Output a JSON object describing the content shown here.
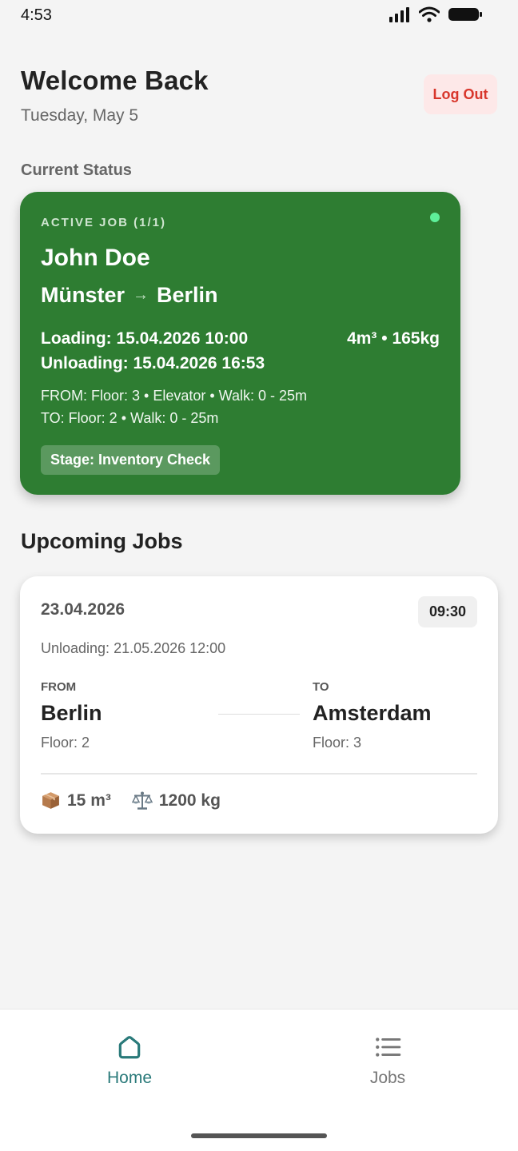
{
  "status_bar": {
    "time": "4:53"
  },
  "header": {
    "title": "Welcome Back",
    "date": "Tuesday, May 5",
    "logout_label": "Log Out"
  },
  "current_status": {
    "label": "Current Status",
    "active_job": {
      "tag": "ACTIVE JOB (1/1)",
      "customer": "John Doe",
      "origin": "Münster",
      "arrow": "→",
      "destination": "Berlin",
      "loading": "Loading: 15.04.2026 10:00",
      "unloading": "Unloading: 15.04.2026 16:53",
      "capacity": "4m³ • 165kg",
      "from_details": "FROM: Floor: 3 • Elevator • Walk: 0 - 25m",
      "to_details": "TO: Floor: 2 • Walk: 0 - 25m",
      "stage": "Stage: Inventory Check",
      "card_color": "#2e7d32",
      "indicator_color": "#5ef09a"
    }
  },
  "upcoming": {
    "title": "Upcoming Jobs",
    "jobs": [
      {
        "date": "23.04.2026",
        "time": "09:30",
        "unloading": "Unloading: 21.05.2026 12:00",
        "from_label": "FROM",
        "from_city": "Berlin",
        "from_floor": "Floor: 2",
        "to_label": "TO",
        "to_city": "Amsterdam",
        "to_floor": "Floor: 3",
        "volume": "15 m³",
        "volume_icon": "package-icon",
        "weight": "1200 kg",
        "weight_icon": "scale-icon"
      }
    ]
  },
  "bottom_nav": {
    "items": [
      {
        "label": "Home",
        "icon": "home-icon",
        "active": true
      },
      {
        "label": "Jobs",
        "icon": "list-icon",
        "active": false
      }
    ],
    "active_color": "#2a7a7a"
  },
  "colors": {
    "background": "#f4f4f4",
    "logout_text": "#d8362b",
    "logout_bg": "#fde8e8"
  }
}
